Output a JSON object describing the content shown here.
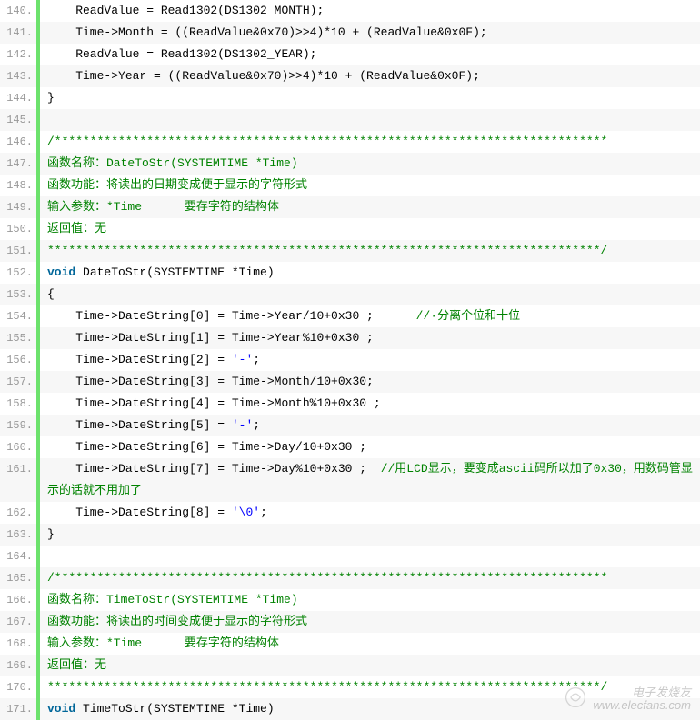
{
  "watermark": {
    "line1": "电子发烧友",
    "line2": "www.elecfans.com"
  },
  "lines": [
    {
      "num": "140.",
      "tokens": [
        {
          "cls": "plain",
          "t": "    ReadValue = Read1302(DS1302_MONTH);"
        }
      ]
    },
    {
      "num": "141.",
      "tokens": [
        {
          "cls": "plain",
          "t": "    Time->Month = ((ReadValue&0x70)>>4)*10 + (ReadValue&0x0F);"
        }
      ]
    },
    {
      "num": "142.",
      "tokens": [
        {
          "cls": "plain",
          "t": "    ReadValue = Read1302(DS1302_YEAR);"
        }
      ]
    },
    {
      "num": "143.",
      "tokens": [
        {
          "cls": "plain",
          "t": "    Time->Year = ((ReadValue&0x70)>>4)*10 + (ReadValue&0x0F);"
        }
      ]
    },
    {
      "num": "144.",
      "tokens": [
        {
          "cls": "plain",
          "t": "}"
        }
      ]
    },
    {
      "num": "145.",
      "tokens": [
        {
          "cls": "plain",
          "t": " "
        }
      ]
    },
    {
      "num": "146.",
      "tokens": [
        {
          "cls": "comment",
          "t": "/******************************************************************************"
        }
      ]
    },
    {
      "num": "147.",
      "tokens": [
        {
          "cls": "comment",
          "t": "函数名称：DateToStr(SYSTEMTIME *Time)"
        }
      ]
    },
    {
      "num": "148.",
      "tokens": [
        {
          "cls": "comment",
          "t": "函数功能：将读出的日期变成便于显示的字符形式"
        }
      ]
    },
    {
      "num": "149.",
      "tokens": [
        {
          "cls": "comment",
          "t": "输入参数：*Time      要存字符的结构体"
        }
      ]
    },
    {
      "num": "150.",
      "tokens": [
        {
          "cls": "comment",
          "t": "返回值：无"
        }
      ]
    },
    {
      "num": "151.",
      "tokens": [
        {
          "cls": "comment",
          "t": "******************************************************************************/"
        }
      ]
    },
    {
      "num": "152.",
      "tokens": [
        {
          "cls": "keyword",
          "t": "void"
        },
        {
          "cls": "plain",
          "t": " DateToStr(SYSTEMTIME *Time)"
        }
      ]
    },
    {
      "num": "153.",
      "tokens": [
        {
          "cls": "plain",
          "t": "{"
        }
      ]
    },
    {
      "num": "154.",
      "tokens": [
        {
          "cls": "plain",
          "t": "    Time->DateString[0] = Time->Year/10+0x30 ;      "
        },
        {
          "cls": "comment",
          "t": "//·分离个位和十位"
        }
      ]
    },
    {
      "num": "155.",
      "tokens": [
        {
          "cls": "plain",
          "t": "    Time->DateString[1] = Time->Year%10+0x30 ;"
        }
      ]
    },
    {
      "num": "156.",
      "tokens": [
        {
          "cls": "plain",
          "t": "    Time->DateString[2] = "
        },
        {
          "cls": "string",
          "t": "'-'"
        },
        {
          "cls": "plain",
          "t": ";"
        }
      ]
    },
    {
      "num": "157.",
      "tokens": [
        {
          "cls": "plain",
          "t": "    Time->DateString[3] = Time->Month/10+0x30;"
        }
      ]
    },
    {
      "num": "158.",
      "tokens": [
        {
          "cls": "plain",
          "t": "    Time->DateString[4] = Time->Month%10+0x30 ;"
        }
      ]
    },
    {
      "num": "159.",
      "tokens": [
        {
          "cls": "plain",
          "t": "    Time->DateString[5] = "
        },
        {
          "cls": "string",
          "t": "'-'"
        },
        {
          "cls": "plain",
          "t": ";"
        }
      ]
    },
    {
      "num": "160.",
      "tokens": [
        {
          "cls": "plain",
          "t": "    Time->DateString[6] = Time->Day/10+0x30 ;"
        }
      ]
    },
    {
      "num": "161.",
      "wrapped": true,
      "tokens": [
        {
          "cls": "plain",
          "t": "    Time->DateString[7] = Time->Day%10+0x30 ;  "
        },
        {
          "cls": "comment",
          "t": "//用LCD显示，要变成ascii码所以加了0x30，用数码管显示的话就不用加了"
        }
      ]
    },
    {
      "num": "162.",
      "tokens": [
        {
          "cls": "plain",
          "t": "    Time->DateString[8] = "
        },
        {
          "cls": "string",
          "t": "'\\0'"
        },
        {
          "cls": "plain",
          "t": ";"
        }
      ]
    },
    {
      "num": "163.",
      "tokens": [
        {
          "cls": "plain",
          "t": "}"
        }
      ]
    },
    {
      "num": "164.",
      "tokens": [
        {
          "cls": "plain",
          "t": " "
        }
      ]
    },
    {
      "num": "165.",
      "tokens": [
        {
          "cls": "comment",
          "t": "/******************************************************************************"
        }
      ]
    },
    {
      "num": "166.",
      "tokens": [
        {
          "cls": "comment",
          "t": "函数名称：TimeToStr(SYSTEMTIME *Time)"
        }
      ]
    },
    {
      "num": "167.",
      "tokens": [
        {
          "cls": "comment",
          "t": "函数功能：将读出的时间变成便于显示的字符形式"
        }
      ]
    },
    {
      "num": "168.",
      "tokens": [
        {
          "cls": "comment",
          "t": "输入参数：*Time      要存字符的结构体"
        }
      ]
    },
    {
      "num": "169.",
      "tokens": [
        {
          "cls": "comment",
          "t": "返回值：无"
        }
      ]
    },
    {
      "num": "170.",
      "tokens": [
        {
          "cls": "comment",
          "t": "******************************************************************************/"
        }
      ]
    },
    {
      "num": "171.",
      "tokens": [
        {
          "cls": "keyword",
          "t": "void"
        },
        {
          "cls": "plain",
          "t": " TimeToStr(SYSTEMTIME *Time)"
        }
      ]
    }
  ]
}
